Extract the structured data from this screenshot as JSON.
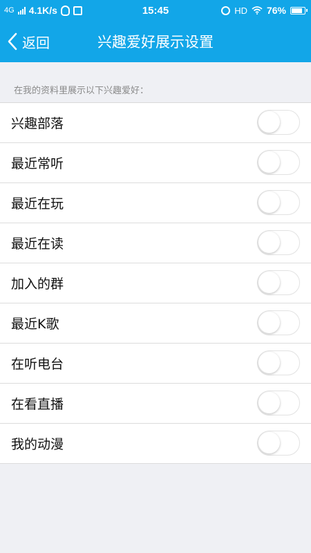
{
  "status_bar": {
    "network_type": "4G",
    "speed": "4.1K/s",
    "time": "15:45",
    "hd": "HD",
    "battery": "76%",
    "icons": [
      "signal-icon",
      "qq-icon",
      "notification-icon",
      "alarm-icon",
      "wifi-icon",
      "battery-icon"
    ]
  },
  "nav": {
    "back_label": "返回",
    "title": "兴趣爱好展示设置"
  },
  "section": {
    "header": "在我的资料里展示以下兴趣爱好："
  },
  "items": [
    {
      "label": "兴趣部落",
      "enabled": false
    },
    {
      "label": "最近常听",
      "enabled": false
    },
    {
      "label": "最近在玩",
      "enabled": false
    },
    {
      "label": "最近在读",
      "enabled": false
    },
    {
      "label": "加入的群",
      "enabled": false
    },
    {
      "label": "最近K歌",
      "enabled": false
    },
    {
      "label": "在听电台",
      "enabled": false
    },
    {
      "label": "在看直播",
      "enabled": false
    },
    {
      "label": "我的动漫",
      "enabled": false
    }
  ],
  "colors": {
    "accent": "#12a6e8",
    "background": "#eff0f4",
    "toggle_off_border": "#e2e2e2"
  }
}
